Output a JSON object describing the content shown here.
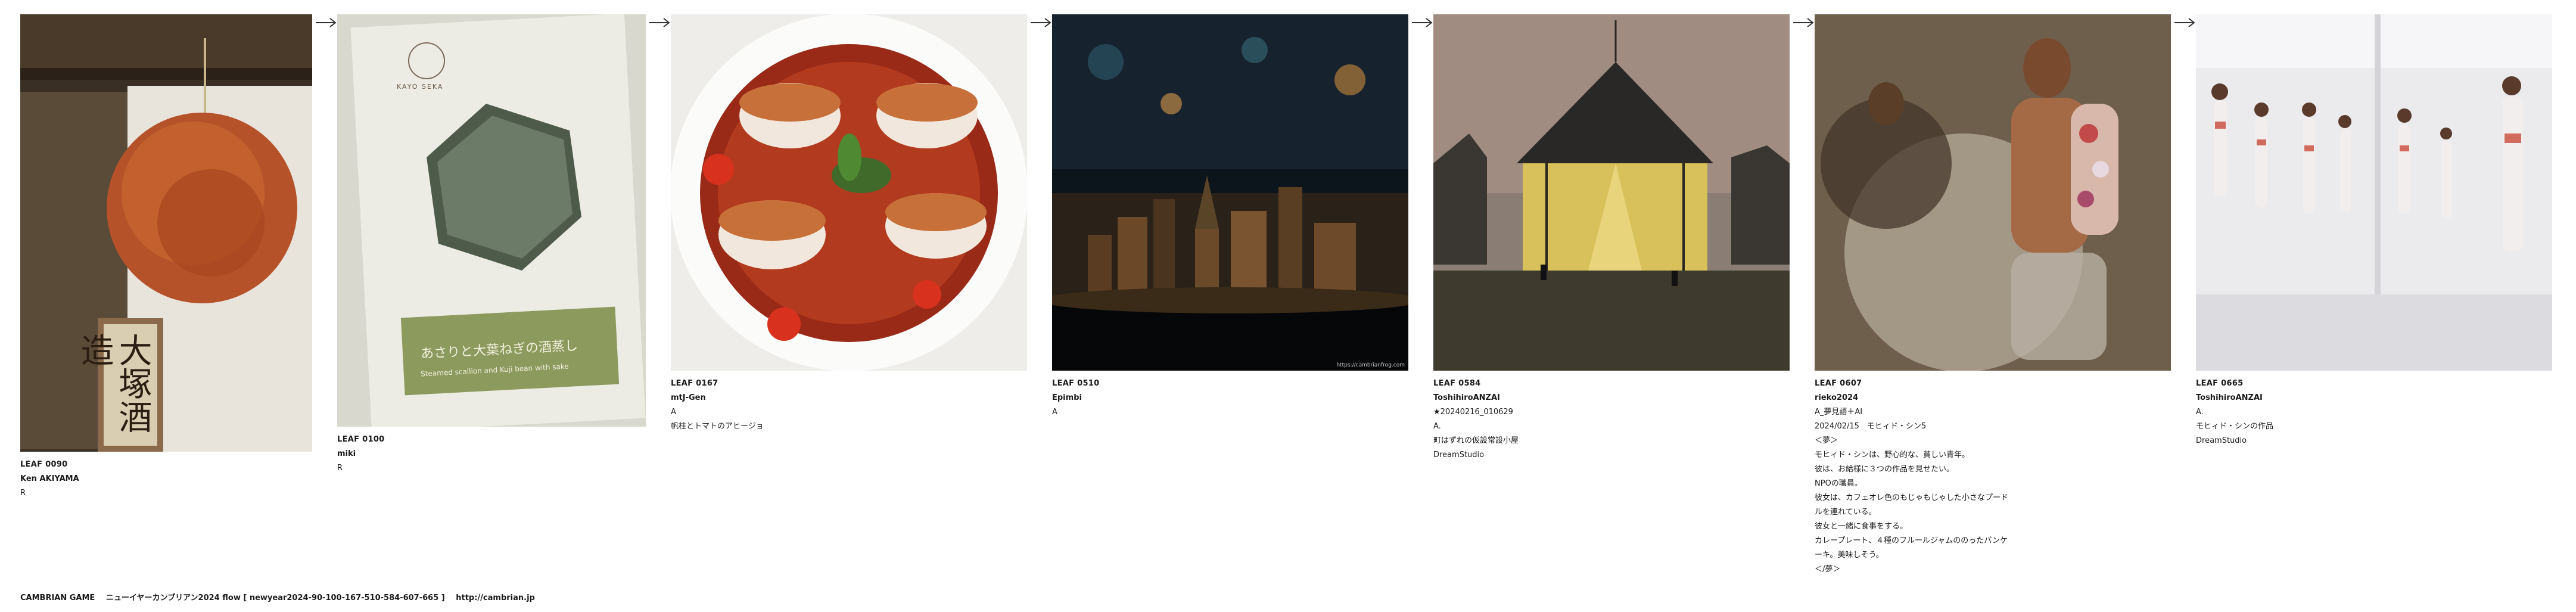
{
  "leaves": [
    {
      "id": "LEAF 0090",
      "author": "Ken AKIYAMA",
      "desc": "R"
    },
    {
      "id": "LEAF 0100",
      "author": "miki",
      "desc": "R"
    },
    {
      "id": "LEAF 0167",
      "author": "mtJ-Gen",
      "desc": "A\n帆柱とトマトのアヒージョ"
    },
    {
      "id": "LEAF 0510",
      "author": "Epimbi",
      "desc": "A"
    },
    {
      "id": "LEAF 0584",
      "author": "ToshihiroANZAI",
      "desc": "★20240216_010629\nA.\n町はずれの仮設常設小屋\nDreamStudio"
    },
    {
      "id": "LEAF 0607",
      "author": "rieko2024",
      "desc": "A_夢見語＋AI\n2024/02/15　モヒィド・シン5\n＜夢＞\nモヒィド・シンは、野心的な、貧しい青年。\n彼は、お給様に３つの作品を見せたい。\nNPOの職員。\n彼女は、カフェオレ色のもじゃもじゃした小さなプード\nルを連れている。\n彼女と一緒に食事をする。\nカレープレート、４種のフルールジャムののったパンケ\nーキ。美味しそう。\n＜/夢＞"
    },
    {
      "id": "LEAF 0665",
      "author": "ToshihiroANZAI",
      "desc": "A.\nモヒィド・シンの作品\nDreamStudio"
    }
  ],
  "sake_sign_text": "大塚酒造",
  "leaf0100_card": {
    "logo": "KAYO SEKA",
    "jp_text": "あさりと大葉ねぎの酒蒸し",
    "en_text": "Steamed scallion and Kuji bean with sake"
  },
  "leaf0510_watermark": "https://cambrianfrog.com",
  "footer": {
    "title": "CAMBRIAN GAME",
    "flow": "ニューイヤーカンブリアン2024  flow [ newyear2024-90-100-167-510-584-607-665 ]",
    "url": "http://cambrian.jp"
  },
  "arrow_icon": "arrow-right-icon"
}
